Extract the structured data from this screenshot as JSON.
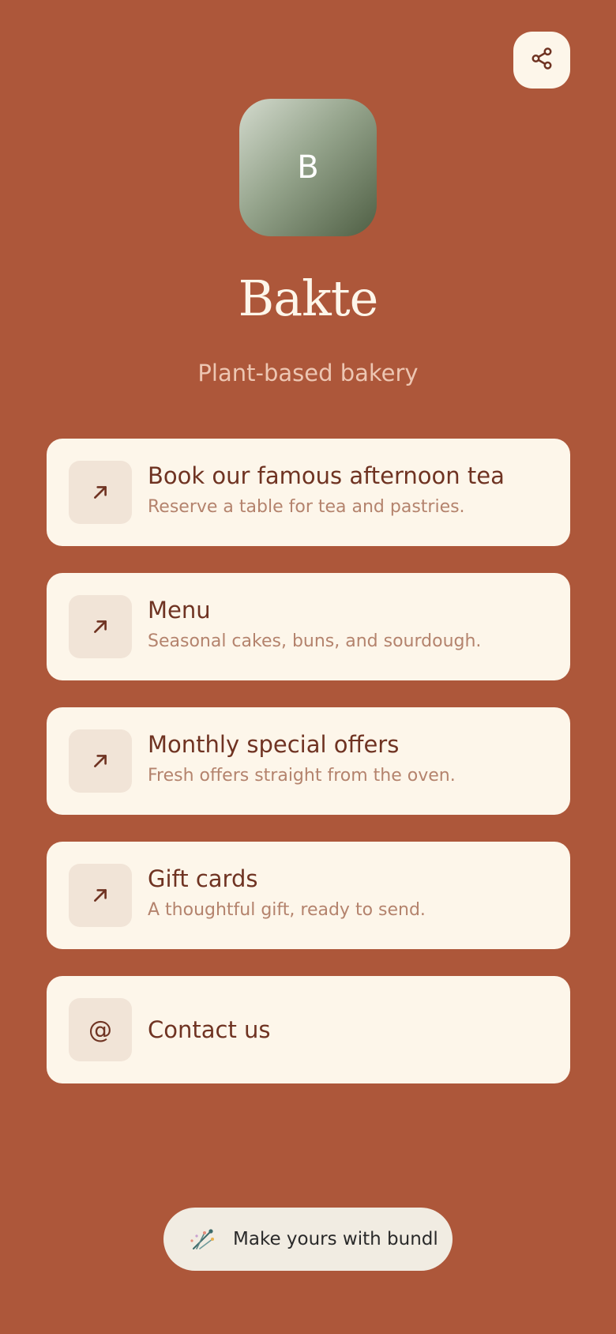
{
  "profile": {
    "initial": "B",
    "name": "Bakte",
    "tagline": "Plant-based bakery"
  },
  "header": {
    "share_icon": "share-icon"
  },
  "links": [
    {
      "icon": "arrow-up-right-icon",
      "title": "Book our famous afternoon tea",
      "description": "Reserve a table for tea and pastries."
    },
    {
      "icon": "arrow-up-right-icon",
      "title": "Menu",
      "description": "Seasonal cakes, buns, and sourdough."
    },
    {
      "icon": "arrow-up-right-icon",
      "title": "Monthly special offers",
      "description": "Fresh offers straight from the oven."
    },
    {
      "icon": "arrow-up-right-icon",
      "title": "Gift cards",
      "description": "A thoughtful gift, ready to send."
    },
    {
      "icon": "at-sign-icon",
      "title": "Contact us",
      "icon_glyph": "@"
    }
  ],
  "footer": {
    "cta_label": "Make yours with bundl",
    "logo_icon": "bundl-logo-icon"
  },
  "colors": {
    "background": "#ad573a",
    "card": "#fdf6ea",
    "card_icon_bg": "#f1e4d7",
    "text_primary": "#6f3322",
    "text_secondary": "#b4836d",
    "tagline": "#edc6b2"
  }
}
